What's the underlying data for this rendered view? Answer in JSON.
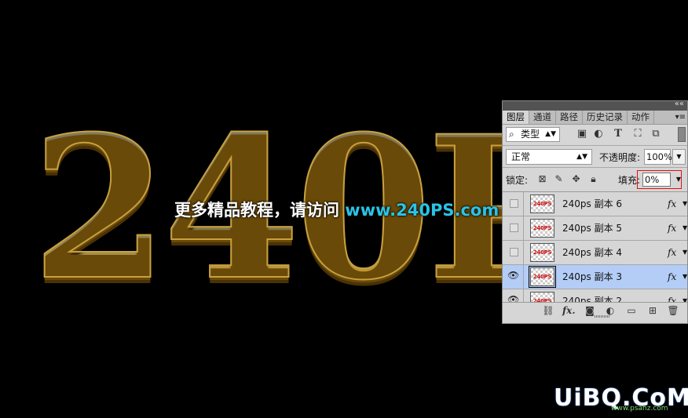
{
  "canvas": {
    "art_text": "240P",
    "watermark_part1": "更多精品教程，请访问",
    "watermark_part2": " www.240PS.com",
    "corner_logo": "UiBQ.CoM",
    "corner_url": "www.psahz.com"
  },
  "panel": {
    "collapse_icon": "««",
    "tabs": [
      "图层",
      "通道",
      "路径",
      "历史记录",
      "动作"
    ],
    "menu_icon": "▾≡",
    "filter": {
      "label": "类型",
      "icons": [
        "image-filter-icon",
        "adjustment-filter-icon",
        "type-filter-icon",
        "shape-filter-icon",
        "smart-object-filter-icon"
      ]
    },
    "blend_mode": "正常",
    "opacity_label": "不透明度:",
    "opacity_value": "100%",
    "lock_label": "锁定:",
    "fill_label": "填充:",
    "fill_value": "0%",
    "layers": [
      {
        "name": "240ps 副本 6",
        "thumb": "240PS",
        "visible": false,
        "selected": false,
        "fx": "fx"
      },
      {
        "name": "240ps 副本 5",
        "thumb": "240PS",
        "visible": false,
        "selected": false,
        "fx": "fx"
      },
      {
        "name": "240ps 副本 4",
        "thumb": "240PS",
        "visible": false,
        "selected": false,
        "fx": "fx"
      },
      {
        "name": "240ps 副本 3",
        "thumb": "240PS",
        "visible": true,
        "selected": true,
        "fx": "fx"
      },
      {
        "name": "240ps 副本 2",
        "thumb": "240PS",
        "visible": true,
        "selected": false,
        "fx": "fx"
      }
    ],
    "bottom_icons": [
      "link-layers-icon",
      "layer-style-icon",
      "layer-mask-icon",
      "adjustment-layer-icon",
      "new-group-icon",
      "new-layer-icon",
      "delete-layer-icon"
    ]
  },
  "colors": {
    "selected_layer": "#b3cdf7",
    "fill_highlight": "#e01010",
    "watermark_url": "#2ac3e6",
    "thumb_text": "#d01010"
  }
}
